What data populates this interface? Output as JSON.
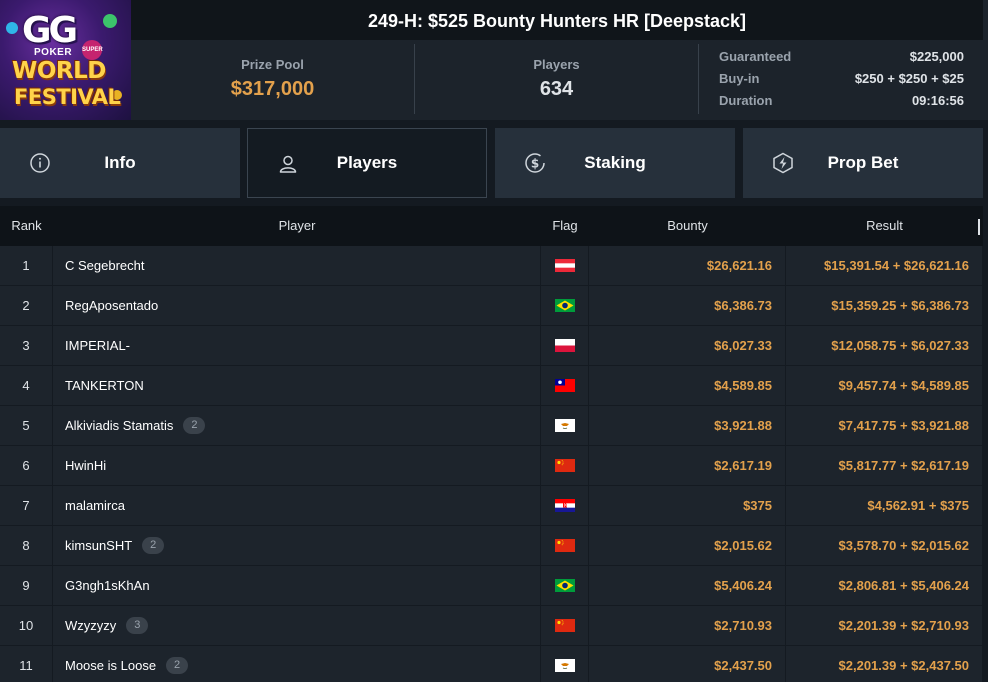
{
  "logo": {
    "gg": "GG",
    "poker": "POKER",
    "super": "SUPER",
    "world": "WORLD",
    "festival": "FESTIVAL"
  },
  "title": "249-H: $525 Bounty Hunters HR [Deepstack]",
  "prize_pool": {
    "label": "Prize Pool",
    "value": "$317,000"
  },
  "players_stat": {
    "label": "Players",
    "value": "634"
  },
  "details": [
    {
      "label": "Guaranteed",
      "value": "$225,000"
    },
    {
      "label": "Buy-in",
      "value": "$250 + $250 + $25"
    },
    {
      "label": "Duration",
      "value": "09:16:56"
    }
  ],
  "tabs": [
    {
      "label": "Info",
      "icon": "info-icon"
    },
    {
      "label": "Players",
      "icon": "user-icon",
      "active": true
    },
    {
      "label": "Staking",
      "icon": "dollar-coin-icon"
    },
    {
      "label": "Prop Bet",
      "icon": "lightning-icon"
    }
  ],
  "table": {
    "headers": {
      "rank": "Rank",
      "player": "Player",
      "flag": "Flag",
      "bounty": "Bounty",
      "result": "Result"
    },
    "rows": [
      {
        "rank": "1",
        "player": "C Segebrecht",
        "badge": "",
        "flag": "austria",
        "bounty": "$26,621.16",
        "result": "$15,391.54 + $26,621.16"
      },
      {
        "rank": "2",
        "player": "RegAposentado",
        "badge": "",
        "flag": "brazil",
        "bounty": "$6,386.73",
        "result": "$15,359.25 + $6,386.73"
      },
      {
        "rank": "3",
        "player": "IMPERIAL-",
        "badge": "",
        "flag": "poland",
        "bounty": "$6,027.33",
        "result": "$12,058.75 + $6,027.33"
      },
      {
        "rank": "4",
        "player": "TANKERTON",
        "badge": "",
        "flag": "taiwan",
        "bounty": "$4,589.85",
        "result": "$9,457.74 + $4,589.85"
      },
      {
        "rank": "5",
        "player": "Alkiviadis Stamatis",
        "badge": "2",
        "flag": "cyprus",
        "bounty": "$3,921.88",
        "result": "$7,417.75 + $3,921.88"
      },
      {
        "rank": "6",
        "player": "HwinHi",
        "badge": "",
        "flag": "china",
        "bounty": "$2,617.19",
        "result": "$5,817.77 + $2,617.19"
      },
      {
        "rank": "7",
        "player": "malamirca",
        "badge": "",
        "flag": "croatia",
        "bounty": "$375",
        "result": "$4,562.91 + $375"
      },
      {
        "rank": "8",
        "player": "kimsunSHT",
        "badge": "2",
        "flag": "china",
        "bounty": "$2,015.62",
        "result": "$3,578.70 + $2,015.62"
      },
      {
        "rank": "9",
        "player": "G3ngh1sKhAn",
        "badge": "",
        "flag": "brazil",
        "bounty": "$5,406.24",
        "result": "$2,806.81 + $5,406.24"
      },
      {
        "rank": "10",
        "player": "Wzyzyzy",
        "badge": "3",
        "flag": "china",
        "bounty": "$2,710.93",
        "result": "$2,201.39 + $2,710.93"
      },
      {
        "rank": "11",
        "player": "Moose is Loose",
        "badge": "2",
        "flag": "cyprus",
        "bounty": "$2,437.50",
        "result": "$2,201.39 + $2,437.50"
      }
    ]
  },
  "colors": {
    "accent_gold": "#e3a14c",
    "background": "#141a21",
    "row_bg": "#1d242c",
    "tab_bg": "#26303b"
  }
}
